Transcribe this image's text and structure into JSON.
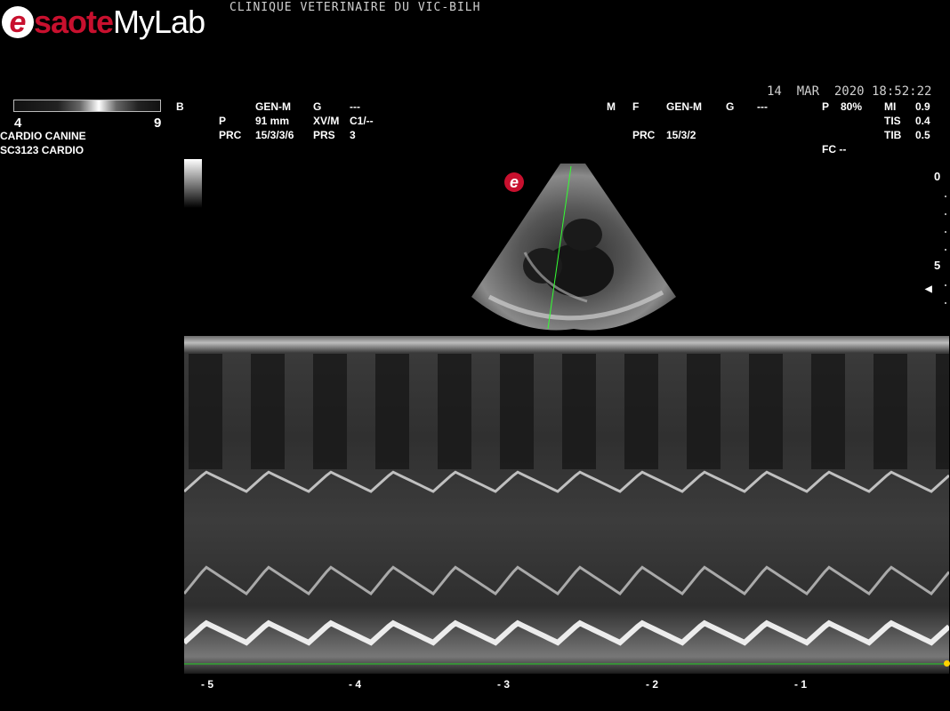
{
  "header": {
    "logo_e": "e",
    "logo_brand": "saote",
    "logo_product": "MyLab",
    "clinic": "CLINIQUE VETERINAIRE DU VIC-BILH",
    "datetime": "14  MAR  2020 18:52:22"
  },
  "grayscale": {
    "min": "4",
    "max": "9"
  },
  "preset": {
    "line1": "CARDIO CANINE",
    "line2": "SC3123  CARDIO"
  },
  "b_mode": {
    "mode": "B",
    "rows": [
      [
        "",
        "GEN-M",
        "G",
        "---"
      ],
      [
        "P",
        "91 mm",
        "XV/M",
        "C1/--"
      ],
      [
        "PRC",
        "15/3/3/6",
        "PRS",
        "3"
      ]
    ]
  },
  "m_mode": {
    "mode": "M",
    "rows": [
      [
        "F",
        "GEN-M",
        "G",
        "---"
      ],
      [
        "",
        "",
        "",
        ""
      ],
      [
        "PRC",
        "15/3/2",
        "",
        ""
      ]
    ]
  },
  "safety": {
    "power_label": "P",
    "power_value": "80%",
    "mi_label": "MI",
    "mi_value": "0.9",
    "tis_label": "TIS",
    "tis_value": "0.4",
    "tib_label": "TIB",
    "tib_value": "0.5",
    "fc": "FC --"
  },
  "depth_scale": {
    "top": "0",
    "mid": "5"
  },
  "logo_small": "e",
  "time_axis": {
    "labels": [
      "- 5",
      "- 4",
      "- 3",
      "- 2",
      "- 1"
    ]
  },
  "colors": {
    "brand_red": "#c8102e",
    "scan_line": "#33ff33",
    "baseline": "#22cc22",
    "marker": "#ffd200"
  }
}
